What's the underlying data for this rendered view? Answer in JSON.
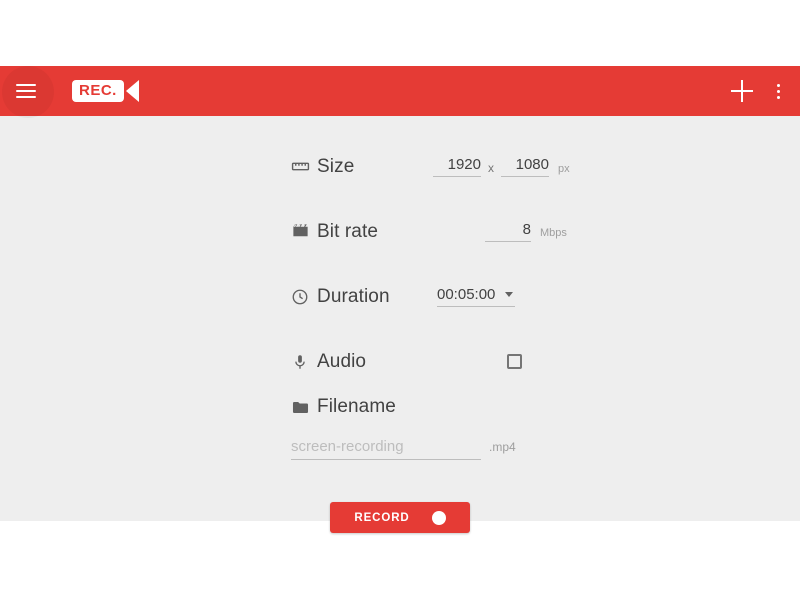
{
  "colors": {
    "brand_red": "#e53b35",
    "app_background": "#eeeeee",
    "page_background": "#ffffff",
    "label_text": "#424242",
    "placeholder_text": "#bdbdbd",
    "unit_text": "#9e9e9e"
  },
  "appbar": {
    "menu_icon": "hamburger-menu-icon",
    "logo_text": "REC.",
    "logo_lens_icon": "video-camera-lens-icon",
    "add_icon": "plus-icon",
    "overflow_icon": "kebab-menu-icon"
  },
  "form": {
    "rows": [
      {
        "key": "size",
        "icon": "ruler-icon",
        "label": "Size",
        "width_value": "1920",
        "separator": "x",
        "height_value": "1080",
        "unit": "px"
      },
      {
        "key": "bitrate",
        "icon": "clapper-board-icon",
        "label": "Bit rate",
        "value": "8",
        "unit": "Mbps"
      },
      {
        "key": "duration",
        "icon": "clock-icon",
        "label": "Duration",
        "value": "00:05:00",
        "dropdown_icon": "chevron-down-icon"
      },
      {
        "key": "audio",
        "icon": "microphone-icon",
        "label": "Audio",
        "checked": false
      },
      {
        "key": "filename",
        "icon": "folder-icon",
        "label": "Filename",
        "placeholder": "screen-recording",
        "value": "",
        "extension": ".mp4"
      }
    ]
  },
  "action": {
    "record_label": "RECORD",
    "record_indicator": "record-dot-icon"
  }
}
